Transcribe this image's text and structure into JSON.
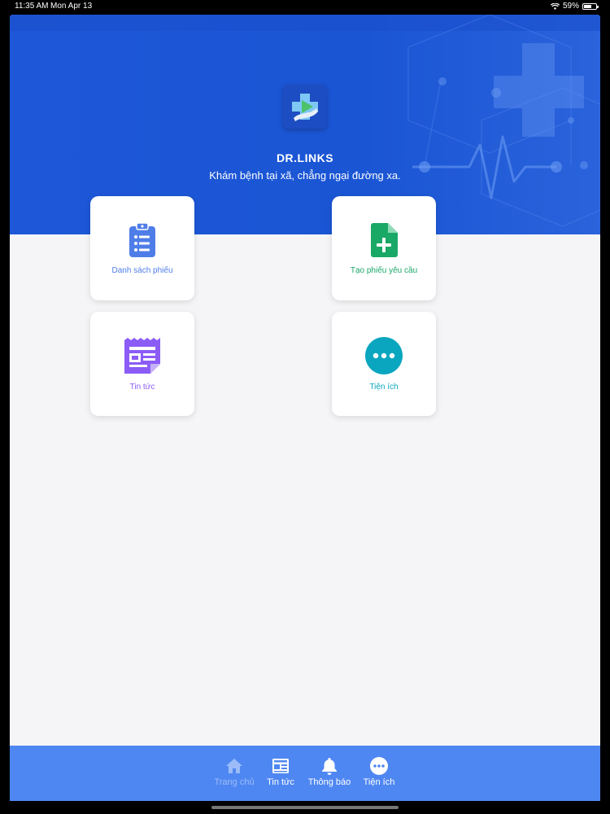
{
  "status_bar": {
    "time": "11:35 AM",
    "date": "Mon Apr 13",
    "battery": "59%",
    "icons": [
      "wifi-icon",
      "battery-icon"
    ]
  },
  "header": {
    "brand": "DR.LINKS",
    "slogan": "Khám bệnh tại xã, chẳng ngại đường xa."
  },
  "menu": [
    {
      "label": "Danh sách phiếu",
      "icon": "clipboard-list-icon",
      "color": "#4f7de8"
    },
    {
      "label": "Tạo phiếu yêu cầu",
      "icon": "file-plus-icon",
      "color": "#1aa866"
    },
    {
      "label": "Tin tức",
      "icon": "newspaper-icon",
      "color": "#8b5cf6"
    },
    {
      "label": "Tiện ích",
      "icon": "more-circle-icon",
      "color": "#0aa6bf"
    }
  ],
  "tabbar": {
    "items": [
      {
        "label": "Trang chủ",
        "icon": "home-icon",
        "active": true
      },
      {
        "label": "Tin tức",
        "icon": "news-icon",
        "active": false
      },
      {
        "label": "Thông báo",
        "icon": "bell-icon",
        "active": false
      },
      {
        "label": "Tiện ích",
        "icon": "more-icon",
        "active": false
      }
    ]
  },
  "colors": {
    "header_blue": "#1e58d8",
    "tabbar_blue": "#4f87f2",
    "background": "#f5f5f7"
  }
}
